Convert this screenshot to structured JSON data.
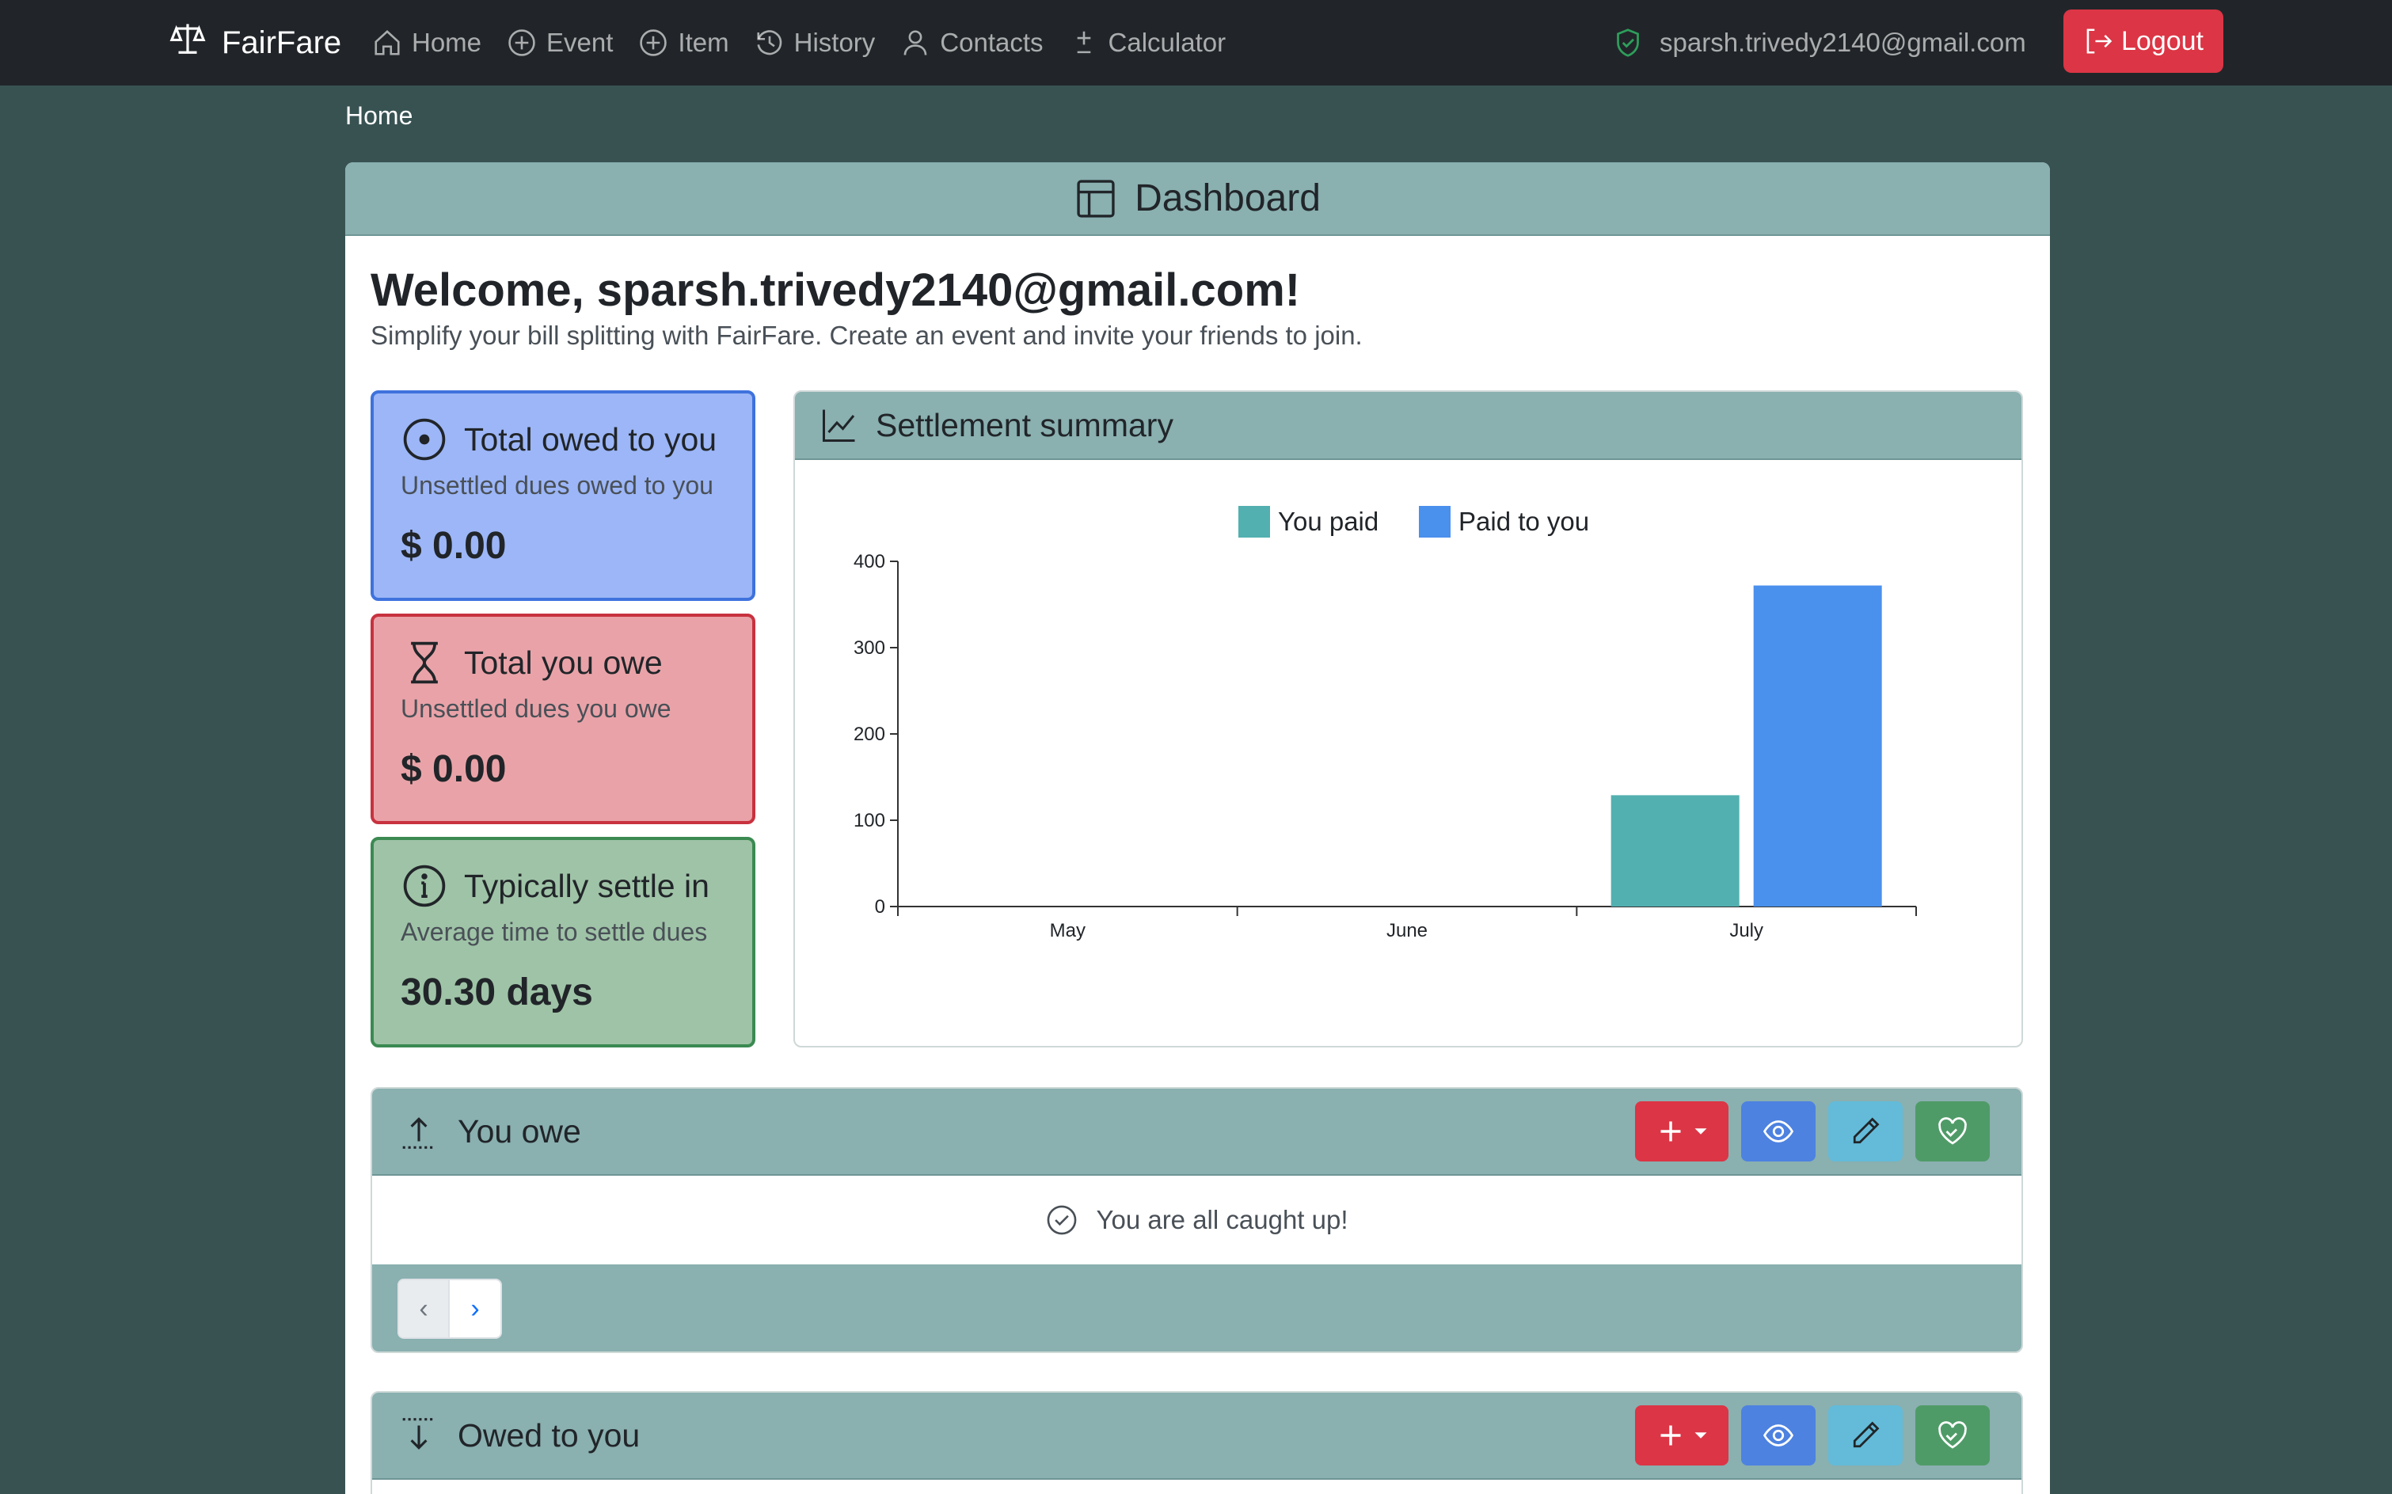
{
  "nav": {
    "brand": "FairFare",
    "links": [
      {
        "label": "Home",
        "icon": "home-icon"
      },
      {
        "label": "Event",
        "icon": "plus-circle-icon"
      },
      {
        "label": "Item",
        "icon": "plus-circle-icon"
      },
      {
        "label": "History",
        "icon": "history-icon"
      },
      {
        "label": "Contacts",
        "icon": "person-icon"
      },
      {
        "label": "Calculator",
        "icon": "plus-minus-icon"
      }
    ],
    "user_email": "sparsh.trivedy2140@gmail.com",
    "logout_label": "Logout"
  },
  "breadcrumb": "Home",
  "dashboard": {
    "title": "Dashboard",
    "welcome": "Welcome, sparsh.trivedy2140@gmail.com!",
    "subtitle": "Simplify your bill splitting with FairFare. Create an event and invite your friends to join."
  },
  "stats": [
    {
      "title": "Total owed to you",
      "subtitle": "Unsettled dues owed to you",
      "value": "$ 0.00",
      "icon": "record-circle-icon",
      "color": "#9cb6f7"
    },
    {
      "title": "Total you owe",
      "subtitle": "Unsettled dues you owe",
      "value": "$ 0.00",
      "icon": "hourglass-icon",
      "color": "#e9a3a8"
    },
    {
      "title": "Typically settle in",
      "subtitle": "Average time to settle dues",
      "value": "30.30 days",
      "icon": "info-circle-icon",
      "color": "#9fc3a7"
    }
  ],
  "chart_title": "Settlement summary",
  "chart_data": {
    "type": "bar",
    "categories": [
      "May",
      "June",
      "July"
    ],
    "series": [
      {
        "name": "You paid",
        "values": [
          0,
          0,
          129
        ],
        "color": "#52b0b0"
      },
      {
        "name": "Paid to you",
        "values": [
          0,
          0,
          372
        ],
        "color": "#4a90ed"
      }
    ],
    "ylim": [
      0,
      400
    ],
    "yticks": [
      0,
      100,
      200,
      300,
      400
    ],
    "legend": "top-center",
    "grid": false
  },
  "sections": {
    "you_owe": {
      "title": "You owe",
      "empty_message": "You are all caught up!",
      "pager_prev": "‹",
      "pager_next": "›"
    },
    "owed_to_you": {
      "title": "Owed to you"
    }
  }
}
